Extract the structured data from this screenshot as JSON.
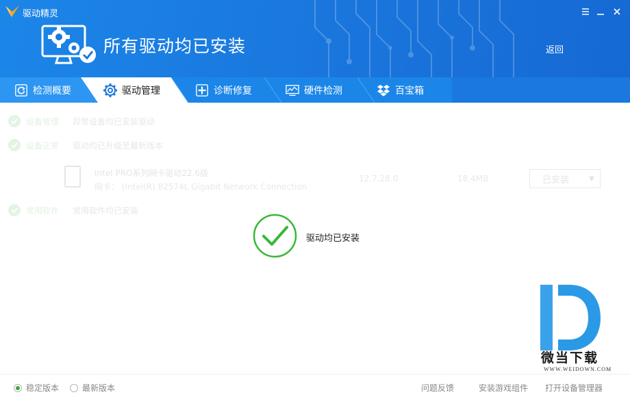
{
  "app": {
    "name": "驱动精灵",
    "hero_title": "所有驱动均已安装",
    "back_label": "返回"
  },
  "tabs": [
    {
      "label": "检测概要",
      "icon": "refresh-icon"
    },
    {
      "label": "驱动管理",
      "icon": "gear-icon",
      "active": true
    },
    {
      "label": "诊断修复",
      "icon": "plus-icon"
    },
    {
      "label": "硬件检测",
      "icon": "chart-monitor-icon"
    },
    {
      "label": "百宝箱",
      "icon": "dropbox-icon"
    }
  ],
  "background_list": {
    "rows": [
      {
        "title": "设备管理",
        "desc": "异常设备均已安装驱动"
      },
      {
        "title": "设备正常",
        "desc": "驱动均已升级至最新版本"
      },
      {
        "title": "常用软件",
        "desc": "常用软件均已安装"
      }
    ],
    "device": {
      "name": "Intel PRO系列网卡驱动22.6版",
      "model": "网卡： (Intel(R) 82574L Gigabit Network Connection",
      "version": "12.7.28.0",
      "size": "18.4MB",
      "status": "已安装"
    }
  },
  "status_message": "驱动均已安装",
  "watermark": {
    "brand": "微当下载",
    "url": "WWW.WEIDOWN.COM"
  },
  "footer": {
    "radio_options": [
      {
        "label": "稳定版本",
        "checked": true
      },
      {
        "label": "最新版本",
        "checked": false
      }
    ],
    "links": [
      "问题反馈",
      "安装游戏组件",
      "打开设备管理器"
    ]
  },
  "colors": {
    "header_blue": "#1a78de",
    "active_tab": "#ffffff",
    "success_green": "#37b337",
    "watermark_blue": "#2a9ae6"
  }
}
